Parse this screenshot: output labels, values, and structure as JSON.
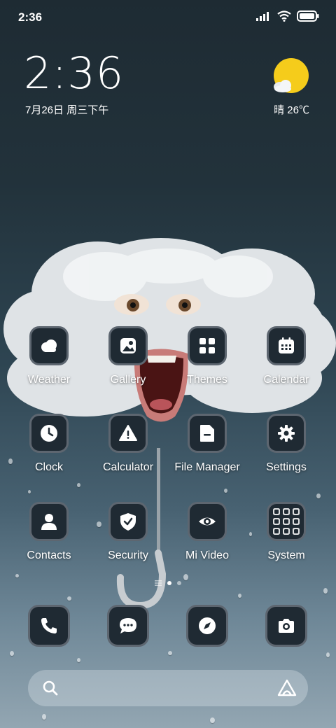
{
  "status_bar": {
    "time": "2:36"
  },
  "clock_widget": {
    "time": "2:36",
    "date": "7月26日 周三下午"
  },
  "weather_widget": {
    "condition_temp": "晴 26℃",
    "icon": "sunny-icon"
  },
  "apps": [
    {
      "label": "Weather",
      "icon": "weather-icon"
    },
    {
      "label": "Gallery",
      "icon": "gallery-icon"
    },
    {
      "label": "Themes",
      "icon": "themes-icon"
    },
    {
      "label": "Calendar",
      "icon": "calendar-icon"
    },
    {
      "label": "Clock",
      "icon": "clock-icon"
    },
    {
      "label": "Calculator",
      "icon": "calculator-icon"
    },
    {
      "label": "File Manager",
      "icon": "file-manager-icon"
    },
    {
      "label": "Settings",
      "icon": "settings-icon"
    },
    {
      "label": "Contacts",
      "icon": "contacts-icon"
    },
    {
      "label": "Security",
      "icon": "security-icon"
    },
    {
      "label": "Mi Video",
      "icon": "mi-video-icon"
    },
    {
      "label": "System",
      "icon": "system-folder-icon"
    }
  ],
  "dock": [
    {
      "icon": "phone-icon"
    },
    {
      "icon": "messages-icon"
    },
    {
      "icon": "browser-icon"
    },
    {
      "icon": "camera-icon"
    }
  ],
  "search_bar": {
    "left_icon": "search-icon",
    "right_icon": "assistant-icon"
  },
  "page_indicator": {
    "pages": 2,
    "current": 1
  }
}
